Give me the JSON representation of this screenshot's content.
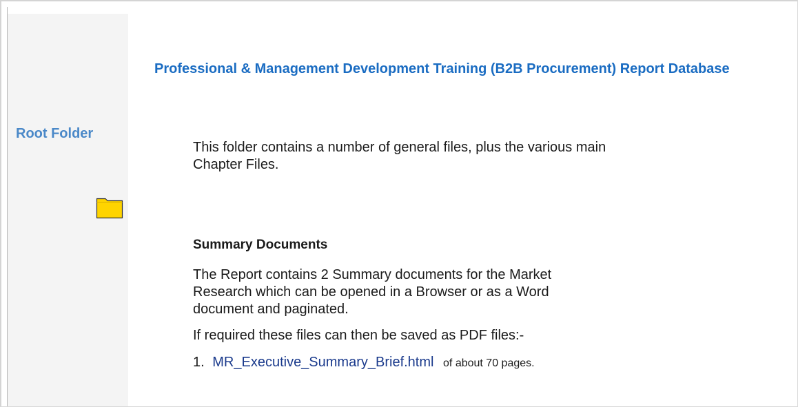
{
  "sidebar": {
    "title": "Root Folder",
    "folder_icon": "folder-icon",
    "folder_color": "#ffd400"
  },
  "main": {
    "title": "Professional & Management Development Training (B2B Procurement) Report Database",
    "intro": "This folder contains a number of general files, plus the various main Chapter Files.",
    "summary_heading": "Summary Documents",
    "summary_text": "The Report contains 2 Summary documents for the Market Research which can be opened in a Browser or as a Word document and paginated.",
    "required_text": "If required these files can then be saved as PDF files:-",
    "list": [
      {
        "number": "1.",
        "link": "MR_Executive_Summary_Brief.html",
        "suffix": "of about 70 pages."
      }
    ]
  },
  "colors": {
    "title": "#1a6cc2",
    "sidebar_title": "#4a88c8",
    "link": "#1a3a8c",
    "sidebar_bg": "#f4f4f4"
  }
}
